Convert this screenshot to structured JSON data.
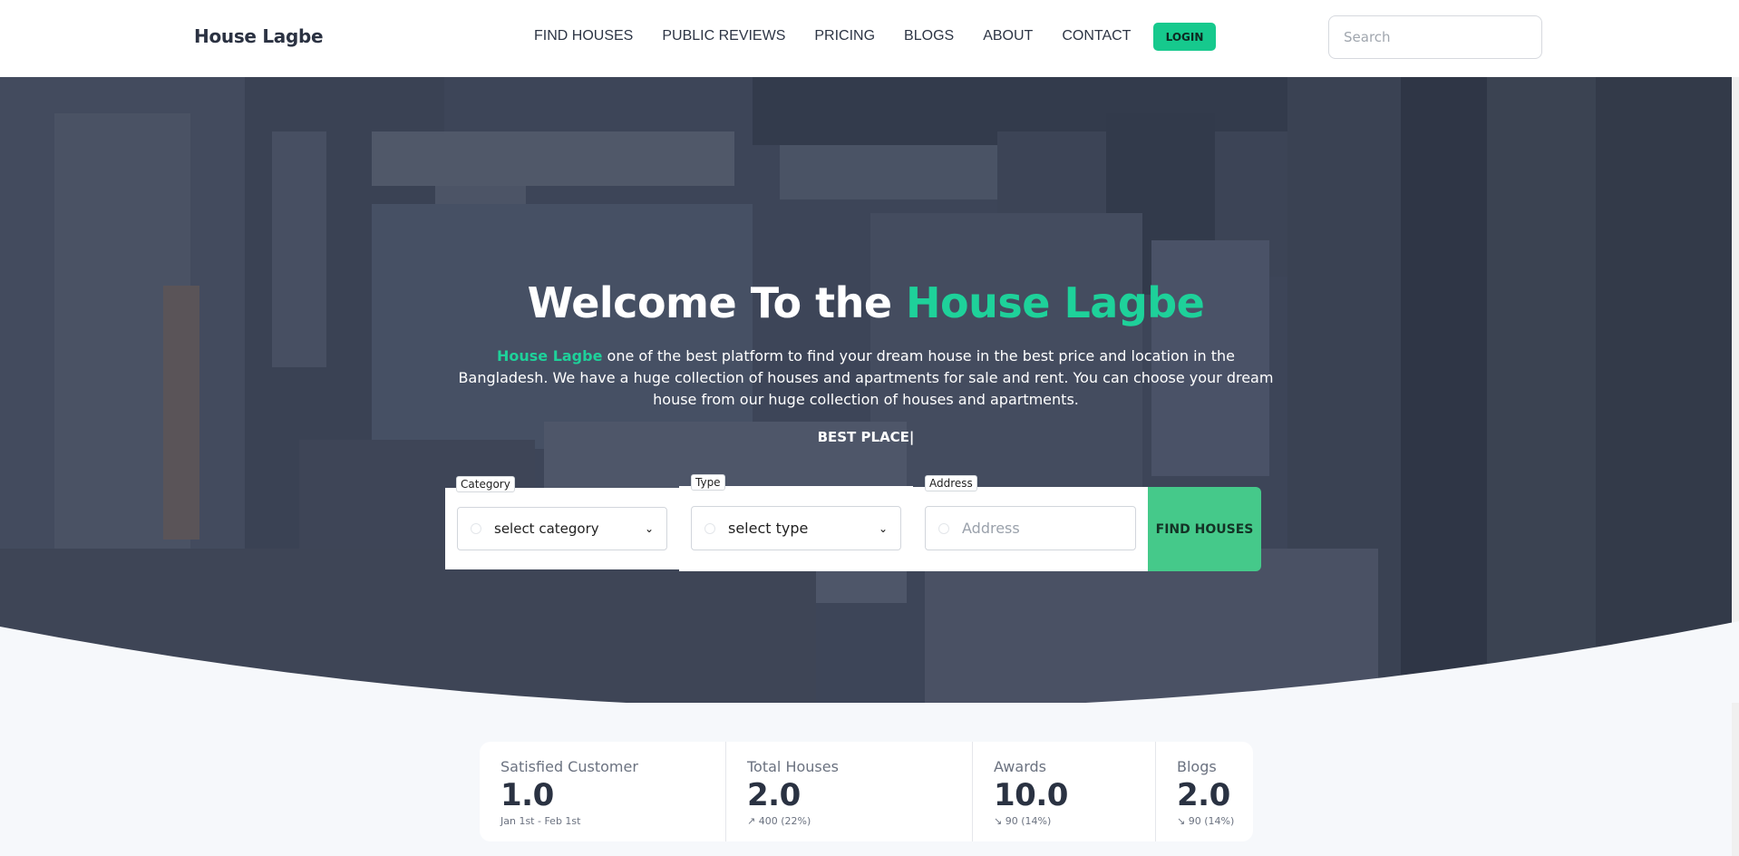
{
  "brand": "House Lagbe",
  "nav": {
    "items": [
      "FIND HOUSES",
      "PUBLIC REVIEWS",
      "PRICING",
      "BLOGS",
      "ABOUT",
      "CONTACT"
    ],
    "login_label": "LOGIN"
  },
  "search": {
    "placeholder": "Search",
    "value": ""
  },
  "hero": {
    "title_prefix": "Welcome To the ",
    "title_accent": "House Lagbe",
    "desc_accent": "House Lagbe",
    "desc_text": " one of the best platform to find your dream house in the best price and location in the Bangladesh. We have a huge collection of houses and apartments for sale and rent. You can choose your dream house from our huge collection of houses and apartments.",
    "typed_text": "BEST PLACE|"
  },
  "search_form": {
    "category_label": "Category",
    "category_value": "select category",
    "type_label": "Type",
    "type_value": "select type",
    "address_label": "Address",
    "address_placeholder": "Address",
    "submit_label": "FIND HOUSES"
  },
  "stats": [
    {
      "title": "Satisfied Customer",
      "value": "1.0",
      "desc": "Jan 1st - Feb 1st"
    },
    {
      "title": "Total Houses",
      "value": "2.0",
      "desc": "↗︎ 400 (22%)"
    },
    {
      "title": "Awards",
      "value": "10.0",
      "desc": "↘︎ 90 (14%)"
    },
    {
      "title": "Blogs",
      "value": "2.0",
      "desc": "↘︎ 90 (14%)"
    }
  ],
  "colors": {
    "accent": "#1ed19a",
    "login_bg": "#16c98d",
    "find_btn_bg": "#45c98a",
    "hero_overlay": "#3b4356",
    "page_bg": "#f6f8fb"
  }
}
